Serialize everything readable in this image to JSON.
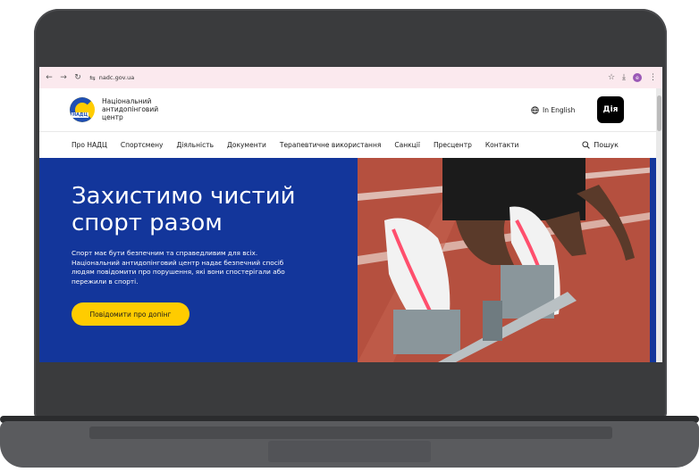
{
  "browser": {
    "back": "←",
    "forward": "→",
    "reload": "↻",
    "url_icon": "⇆",
    "url": "nadc.gov.ua",
    "star": "☆",
    "download": "⤓",
    "profile": "e",
    "menu": "⋮"
  },
  "header": {
    "logo_text": "НАДЦ",
    "org_name": "Національний антидопінговий центр",
    "lang_icon": "globe-icon",
    "lang_label": "In English",
    "diia_label": "Дія"
  },
  "nav": {
    "items": [
      "Про НАДЦ",
      "Спортсмену",
      "Діяльність",
      "Документи",
      "Терапевтичне використання",
      "Санкції",
      "Пресцентр",
      "Контакти"
    ],
    "search_label": "Пошук"
  },
  "hero": {
    "title": "Захистимо чистий спорт разом",
    "text": "Спорт має бути безпечним та справедливим для всіх. Національний антидопінговий центр надає безпечний спосіб людям повідомити про порушення, які вони спостерігали або пережили в спорті.",
    "cta": "Повідомити про допінг"
  },
  "colors": {
    "brand_blue": "#13369b",
    "accent_yellow": "#ffcc00",
    "track_red": "#b5503f"
  }
}
